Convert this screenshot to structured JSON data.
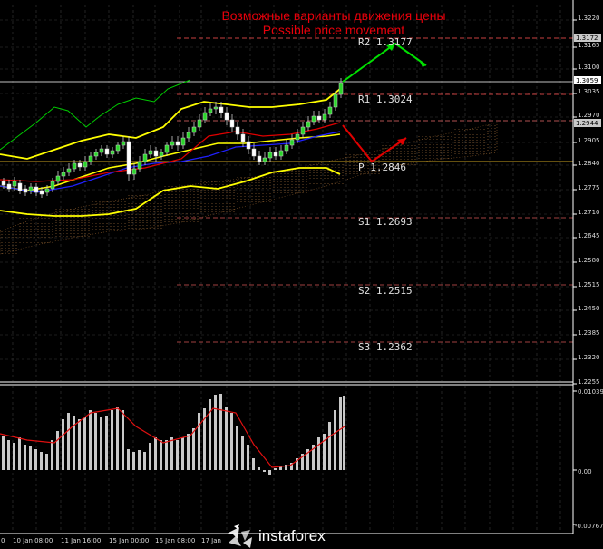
{
  "title_ru": "Возможные варианты движения цены",
  "title_en": "Possible price movement",
  "pivots": [
    {
      "label": "R2",
      "value": "1.3177"
    },
    {
      "label": "R1",
      "value": "1.3024"
    },
    {
      "label": "P",
      "value": "1.2846"
    },
    {
      "label": "S1",
      "value": "1.2693"
    },
    {
      "label": "S2",
      "value": "1.2515"
    },
    {
      "label": "S3",
      "value": "1.2362"
    }
  ],
  "price_axis": [
    "1.3220",
    "1.3165",
    "1.3100",
    "1.3035",
    "1.2970",
    "1.2905",
    "1.2840",
    "1.2775",
    "1.2710",
    "1.2645",
    "1.2580",
    "1.2515",
    "1.2450",
    "1.2385",
    "1.2320",
    "1.2255"
  ],
  "price_tags": [
    {
      "text": "1.3172",
      "color": "#c8c8c8"
    },
    {
      "text": "1.3059",
      "color": "#ffffff"
    },
    {
      "text": "1.2944",
      "color": "#c8c8c8"
    }
  ],
  "osc_axis": [
    "0.01039",
    "0.00",
    "-0.00767"
  ],
  "time_axis": [
    "0",
    "10 Jan 08:00",
    "11 Jan 16:00",
    "15 Jan 00:00",
    "16 Jan 08:00",
    "17 Jan"
  ],
  "logo_text": "instaforex",
  "colors": {
    "background": "#000000",
    "grid": "#3a3a3a",
    "bollinger": "#ffff00",
    "kijun": "#e00000",
    "tenkan": "#2020ff",
    "chikou": "#00cc00",
    "arrow_up": "#00e000",
    "arrow_down": "#e00000"
  }
}
